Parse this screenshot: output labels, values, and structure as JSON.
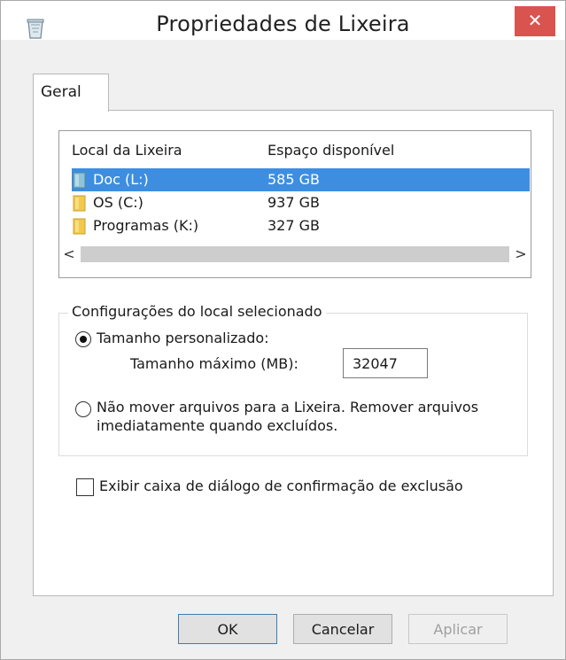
{
  "window": {
    "title": "Propriedades de Lixeira",
    "close_symbol": "✕"
  },
  "tabs": [
    {
      "label": "Geral",
      "selected": true
    }
  ],
  "list": {
    "columns": [
      "Local da Lixeira",
      "Espaço disponível"
    ],
    "rows": [
      {
        "name": "Doc (L:)",
        "space": "585 GB",
        "selected": true,
        "icon": "drive-icon"
      },
      {
        "name": "OS (C:)",
        "space": "937 GB",
        "selected": false,
        "icon": "folder-icon"
      },
      {
        "name": "Programas (K:)",
        "space": "327 GB",
        "selected": false,
        "icon": "folder-icon"
      }
    ],
    "scroll_left": "<",
    "scroll_right": ">"
  },
  "settings": {
    "legend": "Configurações do local selecionado",
    "custom_size_label": "Tamanho personalizado:",
    "max_size_label": "Tamanho máximo (MB):",
    "max_size_value": "32047",
    "custom_size_selected": true,
    "no_move_label_line1": "Não mover arquivos para a Lixeira. Remover arquivos",
    "no_move_label_line2": "imediatamente quando excluídos.",
    "no_move_selected": false
  },
  "confirm": {
    "label": "Exibir caixa de diálogo de confirmação de exclusão",
    "checked": false
  },
  "buttons": {
    "ok": "OK",
    "cancel": "Cancelar",
    "apply": "Aplicar",
    "apply_enabled": false
  },
  "colors": {
    "selection": "#3d8ee0",
    "close_button": "#d9534f"
  }
}
